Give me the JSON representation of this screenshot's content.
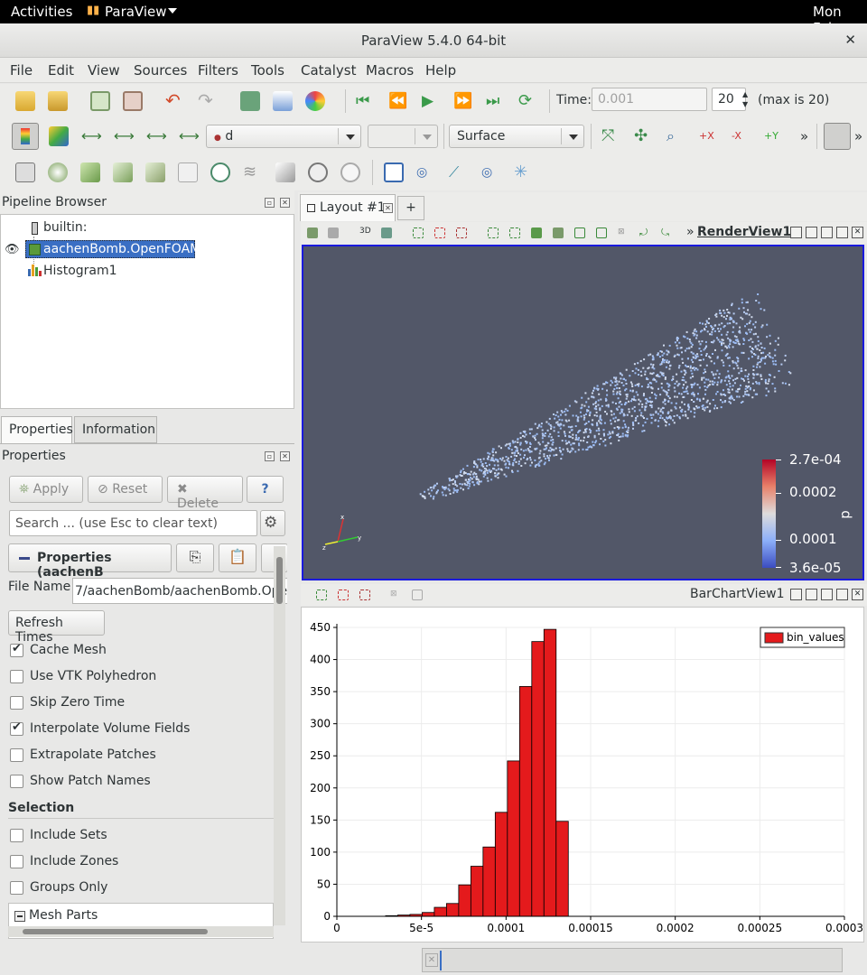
{
  "topbar": {
    "activities": "Activities",
    "app": "ParaView",
    "clock": "Mon Feb"
  },
  "window": {
    "title": "ParaView 5.4.0 64-bit",
    "close": "✕"
  },
  "menu": [
    "File",
    "Edit",
    "View",
    "Sources",
    "Filters",
    "Tools",
    "Catalyst",
    "Macros",
    "Help"
  ],
  "time": {
    "label": "Time:",
    "value": "0.001",
    "step": "20",
    "max": "(max is 20)"
  },
  "toolbar2": {
    "array": "d",
    "representation": "Surface",
    "more": "»"
  },
  "pipeline": {
    "title": "Pipeline Browser",
    "items": [
      "builtin:",
      "aachenBomb.OpenFOAM",
      "Histogram1"
    ]
  },
  "tabs": {
    "properties": "Properties",
    "information": "Information"
  },
  "properties": {
    "title": "Properties",
    "apply": "Apply",
    "reset": "Reset",
    "delete": "Delete",
    "help": "?",
    "search_placeholder": "Search ... (use Esc to clear text)",
    "group": "Properties (aachenB",
    "file_name_label": "File Name",
    "file_name_value": "7/aachenBomb/aachenBomb.Open",
    "refresh": "Refresh Times",
    "checks": [
      {
        "label": "Cache Mesh",
        "on": true
      },
      {
        "label": "Use VTK Polyhedron",
        "on": false
      },
      {
        "label": "Skip Zero Time",
        "on": false
      },
      {
        "label": "Interpolate Volume Fields",
        "on": true
      },
      {
        "label": "Extrapolate Patches",
        "on": false
      },
      {
        "label": "Show Patch Names",
        "on": false
      }
    ],
    "selection_header": "Selection",
    "selection_checks": [
      {
        "label": "Include Sets",
        "on": false
      },
      {
        "label": "Include Zones",
        "on": false
      },
      {
        "label": "Groups Only",
        "on": false
      }
    ],
    "mesh_parts": "Mesh Parts"
  },
  "layout": {
    "tab": "Layout #1",
    "plus": "+"
  },
  "renderview": {
    "name": "RenderView1",
    "toggle3d": "3D",
    "colorbar": {
      "title": "d",
      "labels": [
        "2.7e-04",
        "0.0002",
        "0.0001",
        "3.6e-05"
      ]
    },
    "axes": {
      "x": "x",
      "y": "y",
      "z": "z"
    }
  },
  "barchart": {
    "name": "BarChartView1"
  },
  "chart_data": {
    "type": "bar",
    "legend": [
      "bin_values"
    ],
    "legend_position": "top-right",
    "x_ticks": [
      "0",
      "5e-5",
      "0.0001",
      "0.00015",
      "0.0002",
      "0.00025",
      "0.0003"
    ],
    "y_ticks": [
      "0",
      "50",
      "100",
      "150",
      "200",
      "250",
      "300",
      "350",
      "400",
      "450"
    ],
    "xlim": [
      0,
      0.0003
    ],
    "ylim": [
      0,
      450
    ],
    "bin_width": 7.2e-06,
    "bars": [
      {
        "x": 3.24e-05,
        "y": 1
      },
      {
        "x": 3.96e-05,
        "y": 2
      },
      {
        "x": 4.68e-05,
        "y": 3
      },
      {
        "x": 5.4e-05,
        "y": 6
      },
      {
        "x": 6.12e-05,
        "y": 14
      },
      {
        "x": 6.84e-05,
        "y": 20
      },
      {
        "x": 7.56e-05,
        "y": 49
      },
      {
        "x": 8.28e-05,
        "y": 78
      },
      {
        "x": 9e-05,
        "y": 108
      },
      {
        "x": 9.72e-05,
        "y": 162
      },
      {
        "x": 0.0001044,
        "y": 242
      },
      {
        "x": 0.0001116,
        "y": 358
      },
      {
        "x": 0.0001188,
        "y": 428
      },
      {
        "x": 0.000126,
        "y": 447
      },
      {
        "x": 0.0001332,
        "y": 148
      }
    ],
    "series_color": "#e41a1c",
    "grid": true
  }
}
